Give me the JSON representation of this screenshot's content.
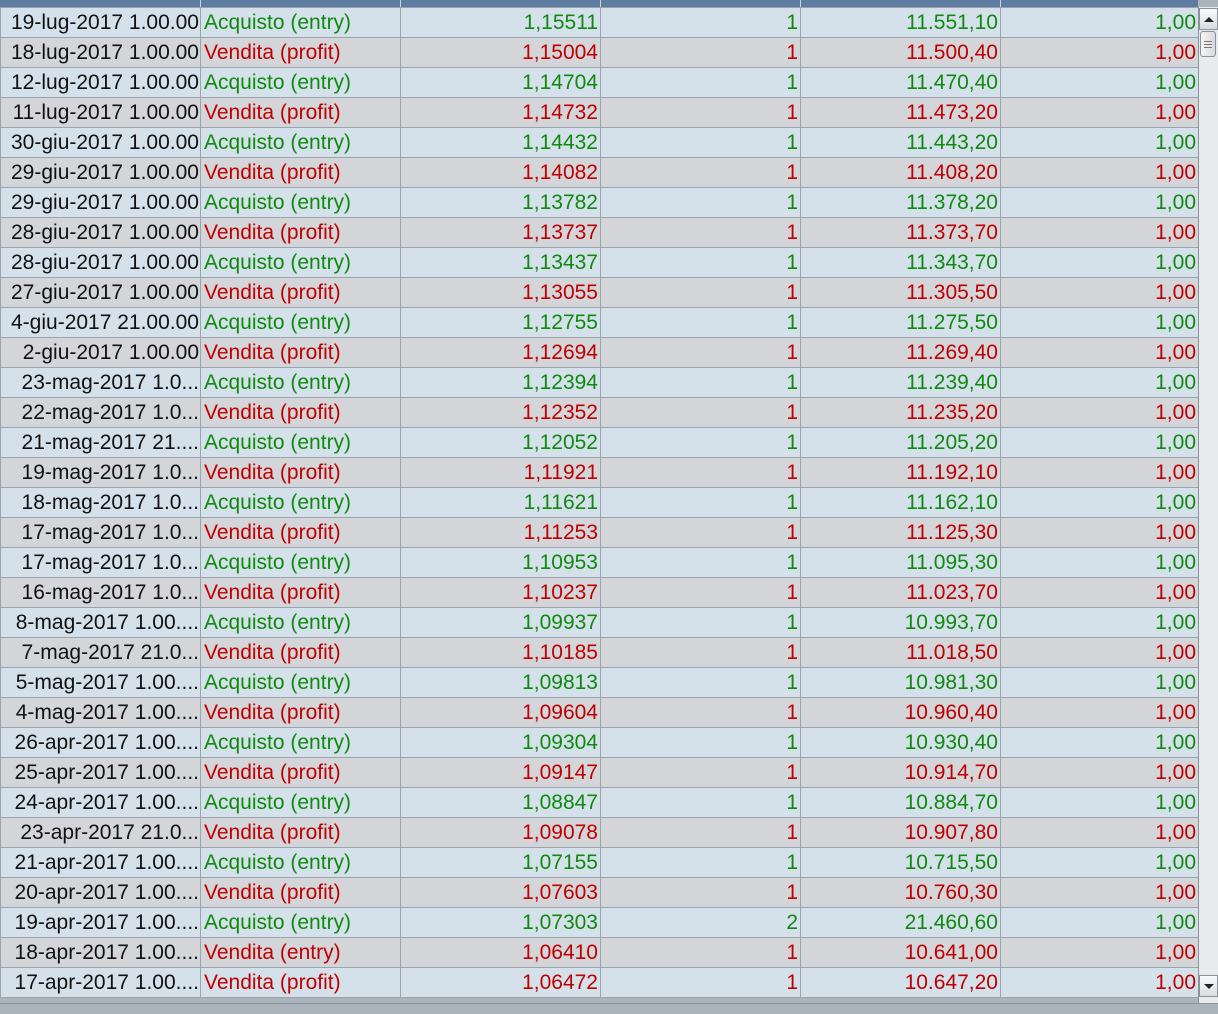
{
  "colors": {
    "buy": "#0f8a0f",
    "sell": "#c00000"
  },
  "rows": [
    {
      "date": "19-lug-2017 1.00.00",
      "type": "Acquisto (entry)",
      "price": "1,15511",
      "qty": "1",
      "value": "11.551,10",
      "commission": "1,00",
      "side": "buy"
    },
    {
      "date": "18-lug-2017 1.00.00",
      "type": "Vendita (profit)",
      "price": "1,15004",
      "qty": "1",
      "value": "11.500,40",
      "commission": "1,00",
      "side": "sell"
    },
    {
      "date": "12-lug-2017 1.00.00",
      "type": "Acquisto (entry)",
      "price": "1,14704",
      "qty": "1",
      "value": "11.470,40",
      "commission": "1,00",
      "side": "buy"
    },
    {
      "date": "11-lug-2017 1.00.00",
      "type": "Vendita (profit)",
      "price": "1,14732",
      "qty": "1",
      "value": "11.473,20",
      "commission": "1,00",
      "side": "sell"
    },
    {
      "date": "30-giu-2017 1.00.00",
      "type": "Acquisto (entry)",
      "price": "1,14432",
      "qty": "1",
      "value": "11.443,20",
      "commission": "1,00",
      "side": "buy"
    },
    {
      "date": "29-giu-2017 1.00.00",
      "type": "Vendita (profit)",
      "price": "1,14082",
      "qty": "1",
      "value": "11.408,20",
      "commission": "1,00",
      "side": "sell"
    },
    {
      "date": "29-giu-2017 1.00.00",
      "type": "Acquisto (entry)",
      "price": "1,13782",
      "qty": "1",
      "value": "11.378,20",
      "commission": "1,00",
      "side": "buy"
    },
    {
      "date": "28-giu-2017 1.00.00",
      "type": "Vendita (profit)",
      "price": "1,13737",
      "qty": "1",
      "value": "11.373,70",
      "commission": "1,00",
      "side": "sell"
    },
    {
      "date": "28-giu-2017 1.00.00",
      "type": "Acquisto (entry)",
      "price": "1,13437",
      "qty": "1",
      "value": "11.343,70",
      "commission": "1,00",
      "side": "buy"
    },
    {
      "date": "27-giu-2017 1.00.00",
      "type": "Vendita (profit)",
      "price": "1,13055",
      "qty": "1",
      "value": "11.305,50",
      "commission": "1,00",
      "side": "sell"
    },
    {
      "date": "4-giu-2017 21.00.00",
      "type": "Acquisto (entry)",
      "price": "1,12755",
      "qty": "1",
      "value": "11.275,50",
      "commission": "1,00",
      "side": "buy"
    },
    {
      "date": "2-giu-2017 1.00.00",
      "type": "Vendita (profit)",
      "price": "1,12694",
      "qty": "1",
      "value": "11.269,40",
      "commission": "1,00",
      "side": "sell"
    },
    {
      "date": "23-mag-2017 1.0...",
      "type": "Acquisto (entry)",
      "price": "1,12394",
      "qty": "1",
      "value": "11.239,40",
      "commission": "1,00",
      "side": "buy"
    },
    {
      "date": "22-mag-2017 1.0...",
      "type": "Vendita (profit)",
      "price": "1,12352",
      "qty": "1",
      "value": "11.235,20",
      "commission": "1,00",
      "side": "sell"
    },
    {
      "date": "21-mag-2017 21....",
      "type": "Acquisto (entry)",
      "price": "1,12052",
      "qty": "1",
      "value": "11.205,20",
      "commission": "1,00",
      "side": "buy"
    },
    {
      "date": "19-mag-2017 1.0...",
      "type": "Vendita (profit)",
      "price": "1,11921",
      "qty": "1",
      "value": "11.192,10",
      "commission": "1,00",
      "side": "sell"
    },
    {
      "date": "18-mag-2017 1.0...",
      "type": "Acquisto (entry)",
      "price": "1,11621",
      "qty": "1",
      "value": "11.162,10",
      "commission": "1,00",
      "side": "buy"
    },
    {
      "date": "17-mag-2017 1.0...",
      "type": "Vendita (profit)",
      "price": "1,11253",
      "qty": "1",
      "value": "11.125,30",
      "commission": "1,00",
      "side": "sell"
    },
    {
      "date": "17-mag-2017 1.0...",
      "type": "Acquisto (entry)",
      "price": "1,10953",
      "qty": "1",
      "value": "11.095,30",
      "commission": "1,00",
      "side": "buy"
    },
    {
      "date": "16-mag-2017 1.0...",
      "type": "Vendita (profit)",
      "price": "1,10237",
      "qty": "1",
      "value": "11.023,70",
      "commission": "1,00",
      "side": "sell"
    },
    {
      "date": "8-mag-2017 1.00....",
      "type": "Acquisto (entry)",
      "price": "1,09937",
      "qty": "1",
      "value": "10.993,70",
      "commission": "1,00",
      "side": "buy"
    },
    {
      "date": "7-mag-2017 21.0...",
      "type": "Vendita (profit)",
      "price": "1,10185",
      "qty": "1",
      "value": "11.018,50",
      "commission": "1,00",
      "side": "sell"
    },
    {
      "date": "5-mag-2017 1.00....",
      "type": "Acquisto (entry)",
      "price": "1,09813",
      "qty": "1",
      "value": "10.981,30",
      "commission": "1,00",
      "side": "buy"
    },
    {
      "date": "4-mag-2017 1.00....",
      "type": "Vendita (profit)",
      "price": "1,09604",
      "qty": "1",
      "value": "10.960,40",
      "commission": "1,00",
      "side": "sell"
    },
    {
      "date": "26-apr-2017 1.00....",
      "type": "Acquisto (entry)",
      "price": "1,09304",
      "qty": "1",
      "value": "10.930,40",
      "commission": "1,00",
      "side": "buy"
    },
    {
      "date": "25-apr-2017 1.00....",
      "type": "Vendita (profit)",
      "price": "1,09147",
      "qty": "1",
      "value": "10.914,70",
      "commission": "1,00",
      "side": "sell"
    },
    {
      "date": "24-apr-2017 1.00....",
      "type": "Acquisto (entry)",
      "price": "1,08847",
      "qty": "1",
      "value": "10.884,70",
      "commission": "1,00",
      "side": "buy"
    },
    {
      "date": "23-apr-2017 21.0...",
      "type": "Vendita (profit)",
      "price": "1,09078",
      "qty": "1",
      "value": "10.907,80",
      "commission": "1,00",
      "side": "sell"
    },
    {
      "date": "21-apr-2017 1.00....",
      "type": "Acquisto (entry)",
      "price": "1,07155",
      "qty": "1",
      "value": "10.715,50",
      "commission": "1,00",
      "side": "buy"
    },
    {
      "date": "20-apr-2017 1.00....",
      "type": "Vendita (profit)",
      "price": "1,07603",
      "qty": "1",
      "value": "10.760,30",
      "commission": "1,00",
      "side": "sell"
    },
    {
      "date": "19-apr-2017 1.00....",
      "type": "Acquisto (entry)",
      "price": "1,07303",
      "qty": "2",
      "value": "21.460,60",
      "commission": "1,00",
      "side": "buy"
    },
    {
      "date": "18-apr-2017 1.00....",
      "type": "Vendita (entry)",
      "price": "1,06410",
      "qty": "1",
      "value": "10.641,00",
      "commission": "1,00",
      "side": "sell"
    },
    {
      "date": "17-apr-2017 1.00....",
      "type": "Vendita (profit)",
      "price": "1,06472",
      "qty": "1",
      "value": "10.647,20",
      "commission": "1,00",
      "side": "sell"
    }
  ]
}
